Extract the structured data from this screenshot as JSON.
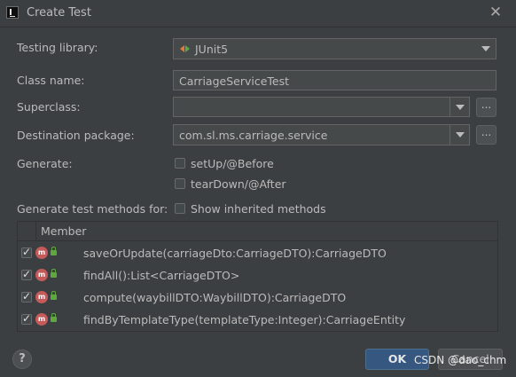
{
  "window": {
    "title": "Create Test"
  },
  "form": {
    "testing_library_label": "Testing library:",
    "testing_library_value": "JUnit5",
    "class_name_label": "Class name:",
    "class_name_value": "CarriageServiceTest",
    "superclass_label": "Superclass:",
    "superclass_value": "",
    "destination_package_label": "Destination package:",
    "destination_package_value": "com.sl.ms.carriage.service",
    "browse_label": "...",
    "generate_label": "Generate:",
    "setup_label": "setUp/@Before",
    "setup_checked": false,
    "teardown_label": "tearDown/@After",
    "teardown_checked": false,
    "generate_methods_label": "Generate test methods for:",
    "show_inherited_label": "Show inherited methods",
    "show_inherited_checked": false
  },
  "members": {
    "header": "Member",
    "icon_letter": "m",
    "rows": [
      {
        "signature": "saveOrUpdate(carriageDto:CarriageDTO):CarriageDTO",
        "checked": true
      },
      {
        "signature": "findAll():List<CarriageDTO>",
        "checked": true
      },
      {
        "signature": "compute(waybillDTO:WaybillDTO):CarriageDTO",
        "checked": true
      },
      {
        "signature": "findByTemplateType(templateType:Integer):CarriageEntity",
        "checked": true
      }
    ]
  },
  "footer": {
    "help_label": "?",
    "ok_label": "OK",
    "cancel_label": "Cancel",
    "watermark": "CSDN @dao_chm"
  },
  "colors": {
    "background": "#3c3f41",
    "ok_button": "#365880",
    "method_icon": "#c55a5a",
    "lock_icon": "#5fa83f"
  }
}
